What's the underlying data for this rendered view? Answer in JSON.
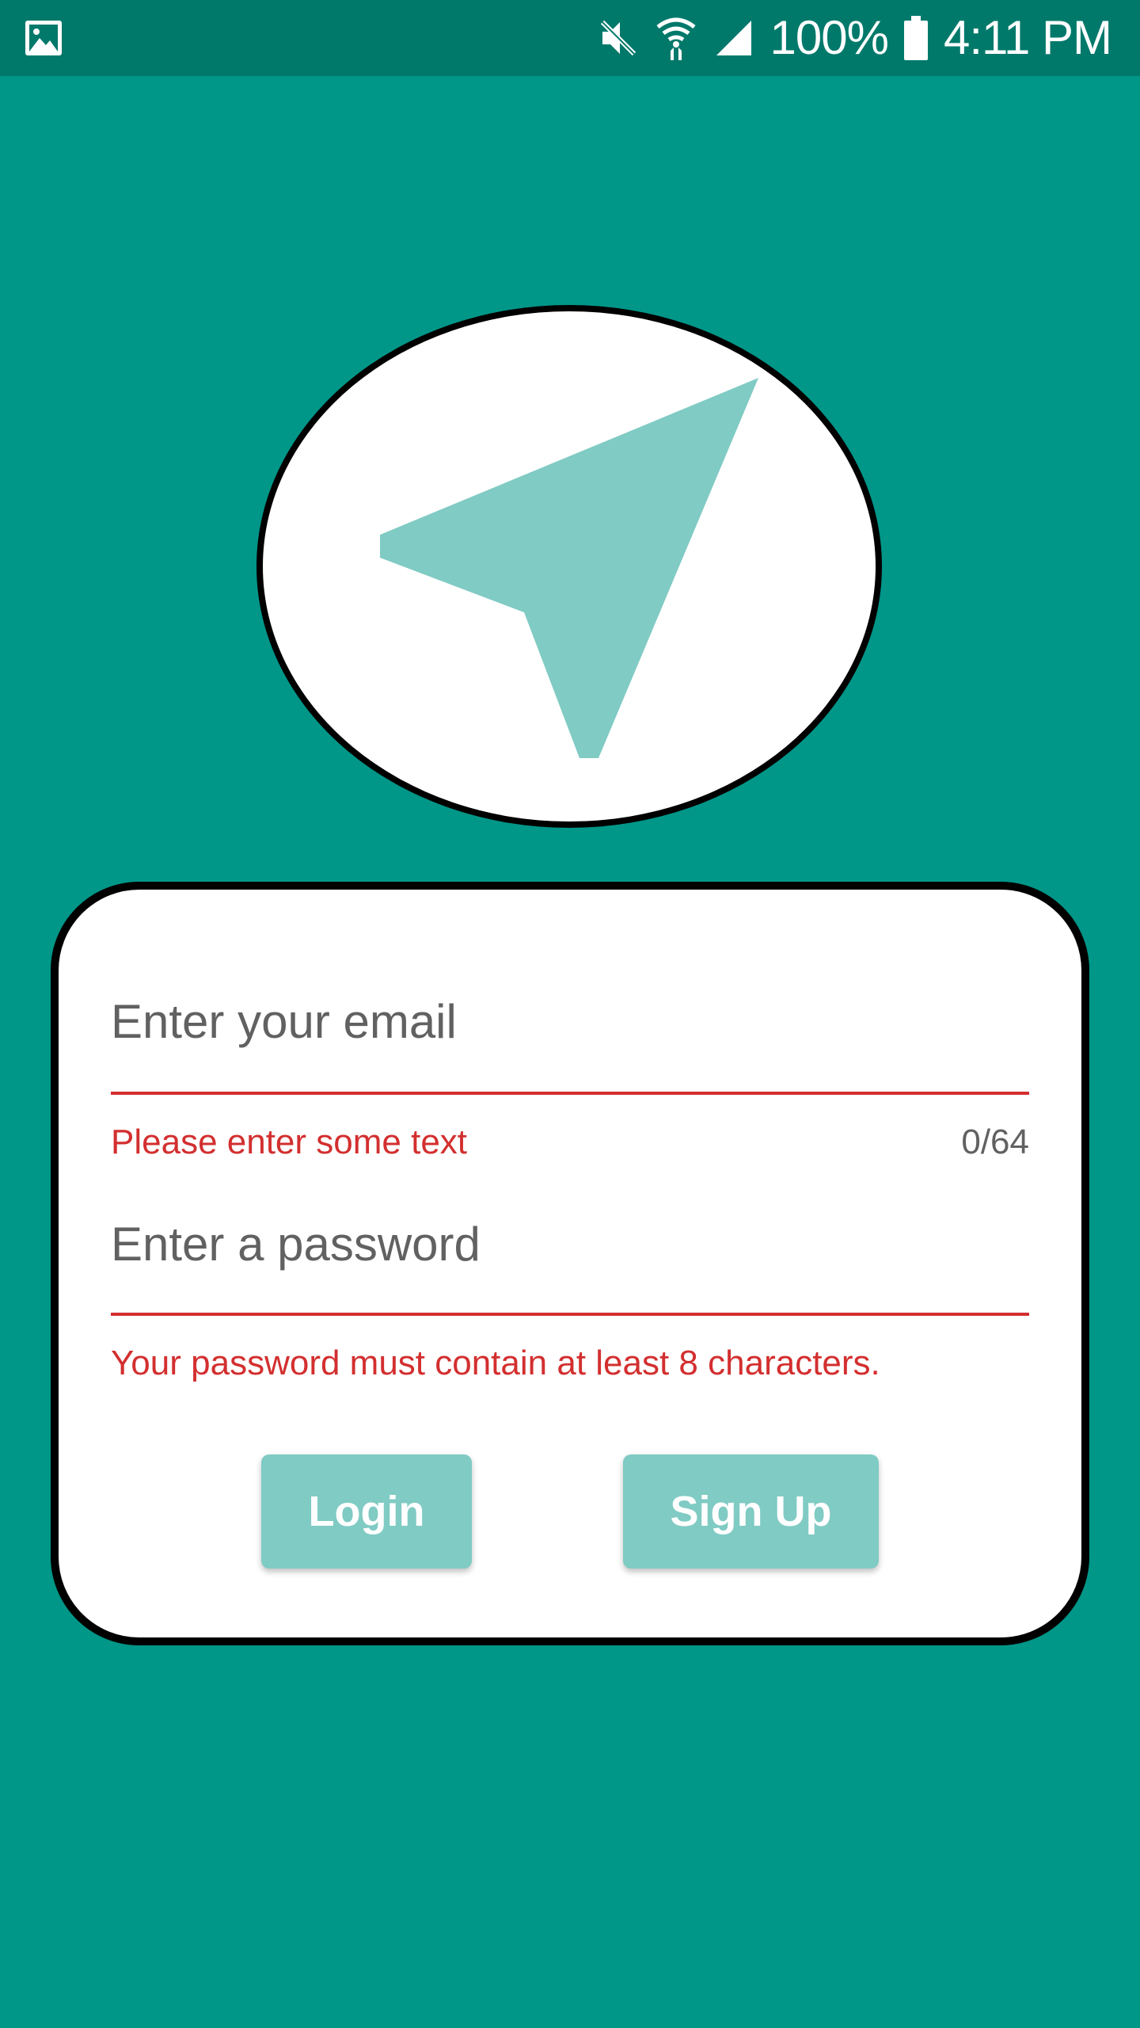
{
  "status_bar": {
    "left_icon": "image-icon",
    "icons": [
      "mute-icon",
      "wifi-icon",
      "signal-icon",
      "battery-icon"
    ],
    "battery": "100%",
    "time": "4:11 PM"
  },
  "logo": {
    "icon": "navigation-arrow-icon",
    "color": "#80CBC4"
  },
  "form": {
    "email": {
      "placeholder": "Enter your email",
      "value": "",
      "error": "Please enter some text",
      "counter": "0/64"
    },
    "password": {
      "placeholder": "Enter a password",
      "value": "",
      "error": "Your password must contain at least 8 characters."
    }
  },
  "buttons": {
    "login": "Login",
    "signup": "Sign Up"
  },
  "colors": {
    "background": "#009688",
    "status_bar": "#00796B",
    "accent": "#80CBC4",
    "error": "#D32F2F"
  }
}
